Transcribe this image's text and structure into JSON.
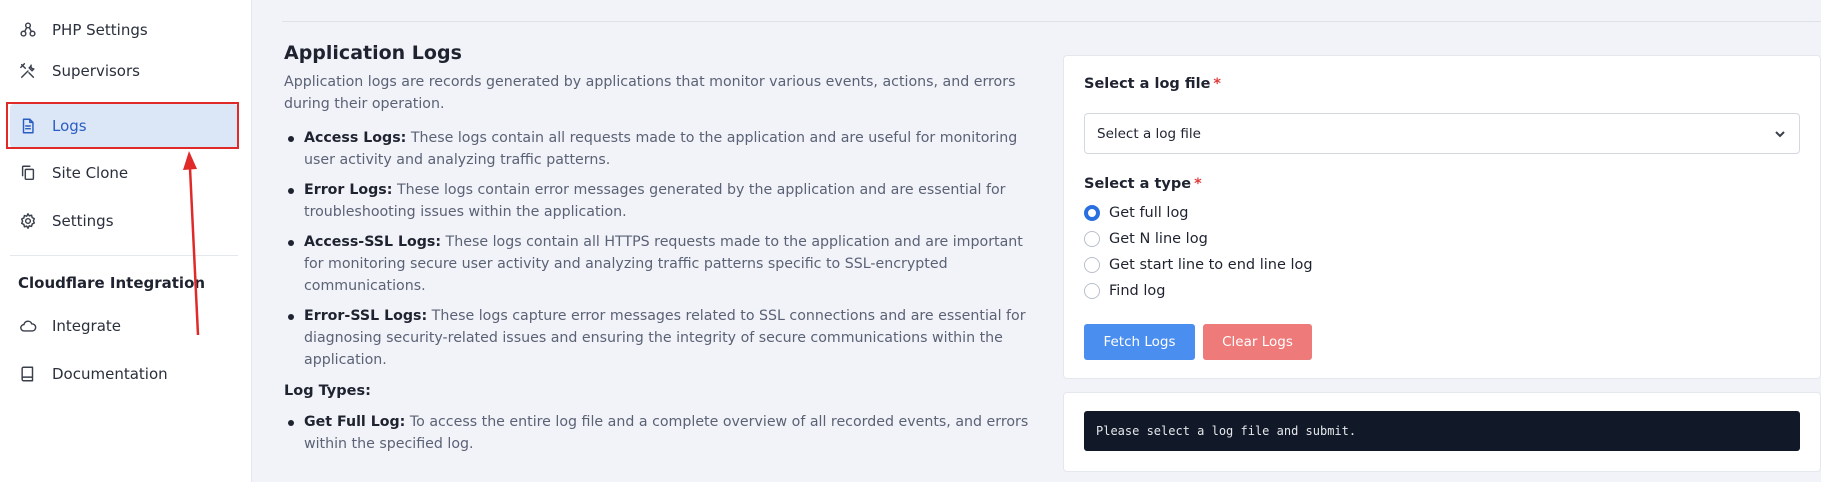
{
  "sidebar": {
    "items": [
      {
        "label": "PHP Settings",
        "icon": "php-settings-icon"
      },
      {
        "label": "Supervisors",
        "icon": "tools-icon"
      },
      {
        "label": "Logs",
        "icon": "document-icon"
      },
      {
        "label": "Site Clone",
        "icon": "copy-icon"
      },
      {
        "label": "Settings",
        "icon": "gear-icon"
      }
    ],
    "section_title": "Cloudflare Integration",
    "section_items": [
      {
        "label": "Integrate",
        "icon": "cloud-icon"
      },
      {
        "label": "Documentation",
        "icon": "book-icon"
      }
    ]
  },
  "main": {
    "title": "Application Logs",
    "intro": "Application logs are records generated by applications that monitor various events, actions, and errors during their operation.",
    "bullets": [
      {
        "term": "Access Logs:",
        "text": " These logs contain all requests made to the application and are useful for monitoring user activity and analyzing traffic patterns."
      },
      {
        "term": "Error Logs:",
        "text": " These logs contain error messages generated by the application and are essential for troubleshooting issues within the application."
      },
      {
        "term": "Access-SSL Logs:",
        "text": " These logs contain all HTTPS requests made to the application and are important for monitoring secure user activity and analyzing traffic patterns specific to SSL-encrypted communications."
      },
      {
        "term": "Error-SSL Logs:",
        "text": " These logs capture error messages related to SSL connections and are essential for diagnosing security-related issues and ensuring the integrity of secure communications within the application."
      }
    ],
    "log_types_heading": "Log Types:",
    "log_type_bullets": [
      {
        "term": "Get Full Log:",
        "text": " To access the entire log file and a complete overview of all recorded events, and errors within the specified log."
      }
    ]
  },
  "form": {
    "file_label": "Select a log file",
    "required_mark": "*",
    "file_select_value": "Select a log file",
    "type_label": "Select a type",
    "types": [
      {
        "label": "Get full log",
        "selected": true
      },
      {
        "label": "Get N line log",
        "selected": false
      },
      {
        "label": "Get start line to end line log",
        "selected": false
      },
      {
        "label": "Find log",
        "selected": false
      }
    ],
    "fetch_button": "Fetch Logs",
    "clear_button": "Clear Logs"
  },
  "output": {
    "message": "Please select a log file and submit."
  },
  "colors": {
    "accent": "#2a6fe0",
    "fetch": "#4a8ef0",
    "clear": "#ee7a7a",
    "highlight": "#e02a2a"
  }
}
